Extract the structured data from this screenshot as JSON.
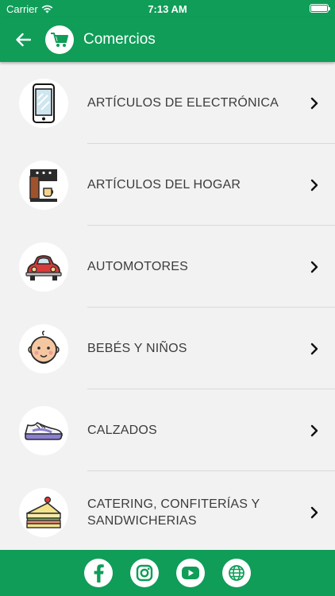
{
  "status_bar": {
    "carrier": "Carrier",
    "time": "7:13 AM",
    "battery_level": 1.0
  },
  "app_bar": {
    "title": "Comercios"
  },
  "categories": [
    {
      "label": "ARTÍCULOS DE ELECTRÓNICA",
      "icon": "smartphone-icon"
    },
    {
      "label": "ARTÍCULOS DEL HOGAR",
      "icon": "coffee-machine-icon"
    },
    {
      "label": "AUTOMOTORES",
      "icon": "car-icon"
    },
    {
      "label": "BEBÉS Y NIÑOS",
      "icon": "baby-icon"
    },
    {
      "label": "CALZADOS",
      "icon": "sneaker-icon"
    },
    {
      "label": "CATERING, CONFITERÍAS Y SANDWICHERIAS",
      "icon": "sandwich-cake-icon"
    }
  ],
  "footer": {
    "icons": [
      "facebook-icon",
      "instagram-icon",
      "youtube-icon",
      "globe-icon"
    ]
  },
  "colors": {
    "primary": "#0f9d58",
    "background": "#f2f2f2",
    "text": "#3c3c3c"
  }
}
